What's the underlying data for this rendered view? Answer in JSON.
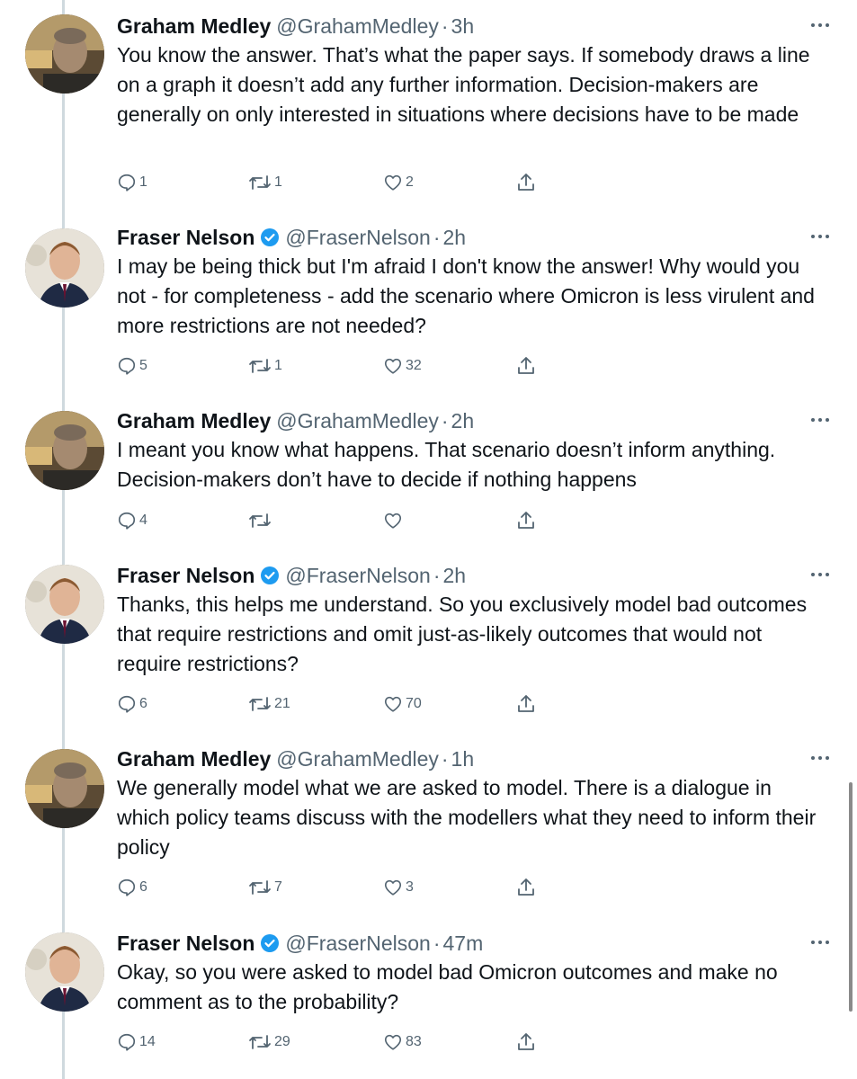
{
  "tweets": [
    {
      "name": "Graham Medley",
      "handle": "@GrahamMedley",
      "time": "3h",
      "verified": false,
      "text": "You know the answer. That’s what the paper says. If somebody draws a line on a graph it doesn’t add any further information. Decision-makers are generally on only interested in situations where decisions have to be made",
      "replies": "1",
      "retweets": "1",
      "likes": "2"
    },
    {
      "name": "Fraser Nelson",
      "handle": "@FraserNelson",
      "time": "2h",
      "verified": true,
      "text": "I may be being thick but I'm afraid I don't know the answer! Why would you not - for completeness - add the scenario where Omicron is less virulent and more restrictions are not needed?",
      "replies": "5",
      "retweets": "1",
      "likes": "32"
    },
    {
      "name": "Graham Medley",
      "handle": "@GrahamMedley",
      "time": "2h",
      "verified": false,
      "text": "I meant you know what happens. That scenario doesn’t inform anything. Decision-makers don’t have to decide if nothing happens",
      "replies": "4",
      "retweets": "",
      "likes": ""
    },
    {
      "name": "Fraser Nelson",
      "handle": "@FraserNelson",
      "time": "2h",
      "verified": true,
      "text": "Thanks, this helps me understand. So you exclusively model bad outcomes that require restrictions and omit just-as-likely outcomes that would not require restrictions?",
      "replies": "6",
      "retweets": "21",
      "likes": "70"
    },
    {
      "name": "Graham Medley",
      "handle": "@GrahamMedley",
      "time": "1h",
      "verified": false,
      "text": "We generally model what we are asked to model. There is a dialogue in which policy teams discuss with the modellers what they need to inform their policy",
      "replies": "6",
      "retweets": "7",
      "likes": "3"
    },
    {
      "name": "Fraser Nelson",
      "handle": "@FraserNelson",
      "time": "47m",
      "verified": true,
      "text": "Okay, so you were asked to model bad Omicron outcomes and make no comment as to the probability?",
      "replies": "14",
      "retweets": "29",
      "likes": "83"
    }
  ],
  "separator": "·",
  "colors": {
    "verified": "#1d9bf0",
    "secondary_text": "#536471",
    "thread_line": "#cfd9de"
  }
}
